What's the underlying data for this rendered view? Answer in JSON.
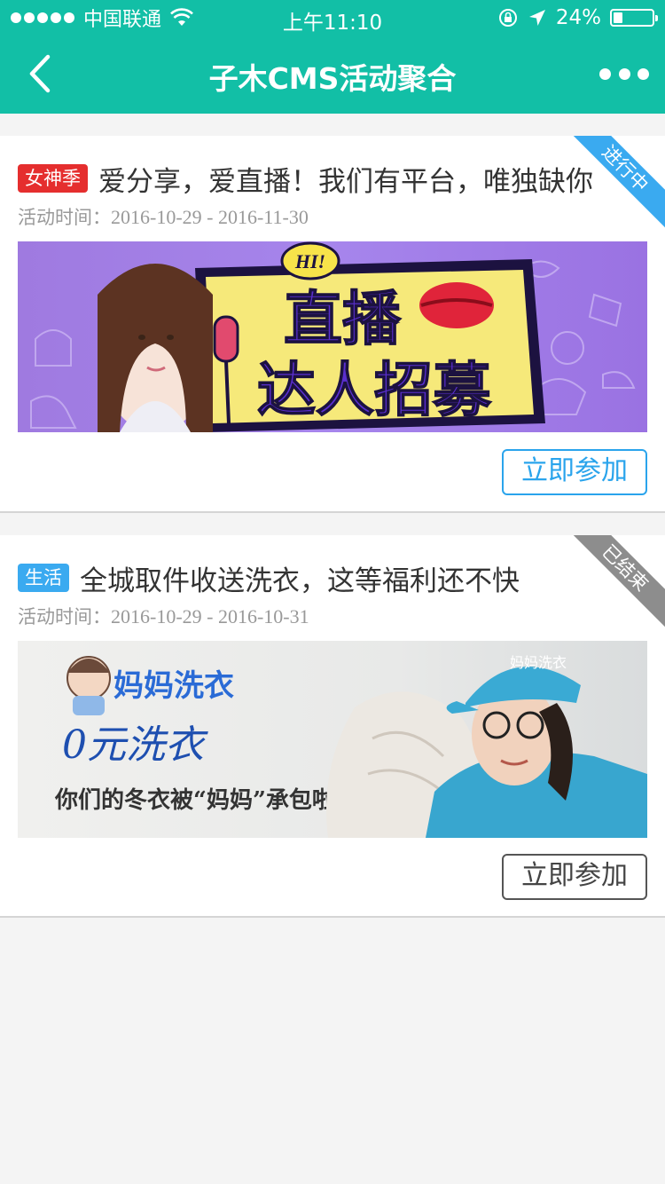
{
  "status_bar": {
    "carrier": "中国联通",
    "time": "上午11:10",
    "battery": "24%",
    "battery_level": 0.24
  },
  "nav": {
    "title": "子木CMS活动聚合",
    "back_icon": "chevron-left-icon",
    "more_icon": "more-dots-icon"
  },
  "theme": {
    "header_color": "#12bfa6",
    "active_color": "#3aaaf0",
    "ended_color": "#8d8d8d",
    "tag_red": "#e52e2e"
  },
  "activities": [
    {
      "tag": "女神季",
      "title": "爱分享，爱直播！我们有平台，唯独缺你",
      "time_label": "活动时间：",
      "time_range": "2016-10-29 - 2016-11-30",
      "status": "进行中",
      "banner": {
        "badge": "HI!",
        "headline_1": "直播",
        "headline_2": "达人招募"
      },
      "join_label": "立即参加"
    },
    {
      "tag": "生活",
      "title": "全城取件收送洗衣，这等福利还不快",
      "time_label": "活动时间：",
      "time_range": "2016-10-29 - 2016-10-31",
      "status": "已结束",
      "banner": {
        "brand": "妈妈洗衣",
        "headline": "0元洗衣",
        "subline": "你们的冬衣被“妈妈”承包啦",
        "cap_text": "妈妈洗衣"
      },
      "join_label": "立即参加"
    }
  ]
}
